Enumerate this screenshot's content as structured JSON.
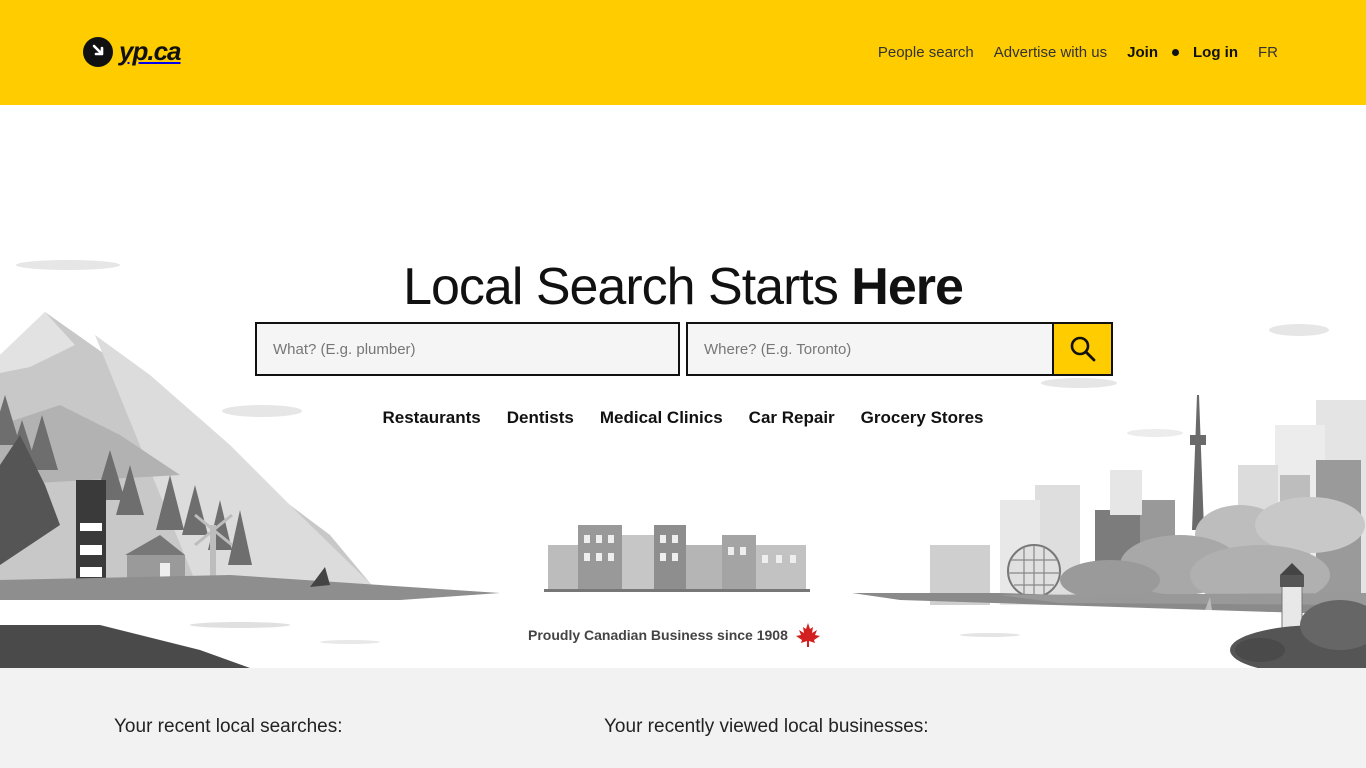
{
  "header": {
    "logo_text": "yp.ca",
    "nav": {
      "people_search": "People search",
      "advertise": "Advertise with us",
      "join": "Join",
      "login": "Log in",
      "language": "FR"
    }
  },
  "hero": {
    "headline_light": "Local Search Starts ",
    "headline_bold": "Here",
    "what_placeholder": "What? (E.g. plumber)",
    "where_placeholder": "Where? (E.g. Toronto)",
    "categories": [
      "Restaurants",
      "Dentists",
      "Medical Clinics",
      "Car Repair",
      "Grocery Stores"
    ],
    "proud_text": "Proudly Canadian Business since 1908"
  },
  "bottom": {
    "recent_searches": "Your recent local searches:",
    "recently_viewed": "Your recently viewed local businesses:"
  },
  "colors": {
    "brand_yellow": "#ffcc00",
    "text_dark": "#111111",
    "bottom_bg": "#f2f2f2",
    "maple_red": "#d21f1f"
  }
}
